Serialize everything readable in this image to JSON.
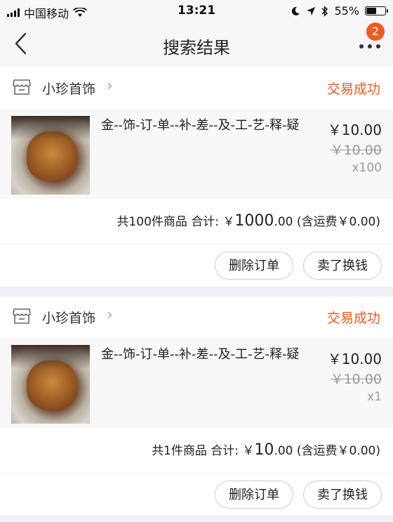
{
  "status_bar": {
    "carrier": "中国移动",
    "time": "13:21",
    "battery": "55%",
    "battery_level": 0.55
  },
  "nav": {
    "title": "搜索结果",
    "badge_count": "2"
  },
  "orders": [
    {
      "shop_name": "小珍首饰",
      "status": "交易成功",
      "item_title": "金--饰-订-单--补-差--及-工-艺-释-疑",
      "price": "￥10.00",
      "original_price": "￥10.00",
      "quantity": "x100",
      "summary_count": "共100件商品 合计: ￥",
      "summary_amount_int": "1000",
      "summary_amount_dec": ".00",
      "summary_shipping": " (含运费￥0.00)",
      "delete_label": "删除订单",
      "sell_label": "卖了换钱"
    },
    {
      "shop_name": "小珍首饰",
      "status": "交易成功",
      "item_title": "金--饰-订-单--补-差--及-工-艺-释-疑",
      "price": "￥10.00",
      "original_price": "￥10.00",
      "quantity": "x1",
      "summary_count": "共1件商品 合计: ￥",
      "summary_amount_int": "10",
      "summary_amount_dec": ".00",
      "summary_shipping": " (含运费￥0.00)",
      "delete_label": "删除订单",
      "sell_label": "卖了换钱"
    }
  ]
}
